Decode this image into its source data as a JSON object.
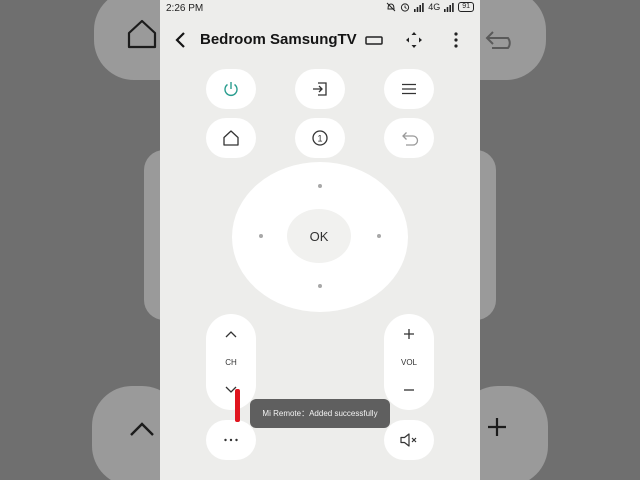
{
  "status_bar": {
    "time": "2:26 PM",
    "network": "4G",
    "battery": "91"
  },
  "app_bar": {
    "title": "Bedroom SamsungTV",
    "icons": [
      "back-arrow-icon",
      "keyboard-icon",
      "dpad-toggle-icon",
      "more-vertical-icon"
    ]
  },
  "remote": {
    "row1": [
      "power-icon",
      "input-source-icon",
      "menu-icon"
    ],
    "row2": [
      "home-icon",
      "number-pad-icon",
      "return-icon"
    ],
    "number_pad_badge": "1",
    "ok_label": "OK",
    "channel": {
      "label": "CH",
      "up_icon": "chevron-up-icon",
      "down_icon": "chevron-down-icon"
    },
    "volume": {
      "label": "VOL",
      "up_icon": "plus-icon",
      "down_icon": "minus-icon"
    },
    "more_icon": "more-horizontal-icon",
    "mute_icon": "mute-icon"
  },
  "toast": {
    "message": "Mi Remote：Added successfully"
  },
  "colors": {
    "accent": "#2a9d8f",
    "toast_bg": "#5f5f5f",
    "marker": "#e0141e",
    "panel": "#ededeb"
  }
}
